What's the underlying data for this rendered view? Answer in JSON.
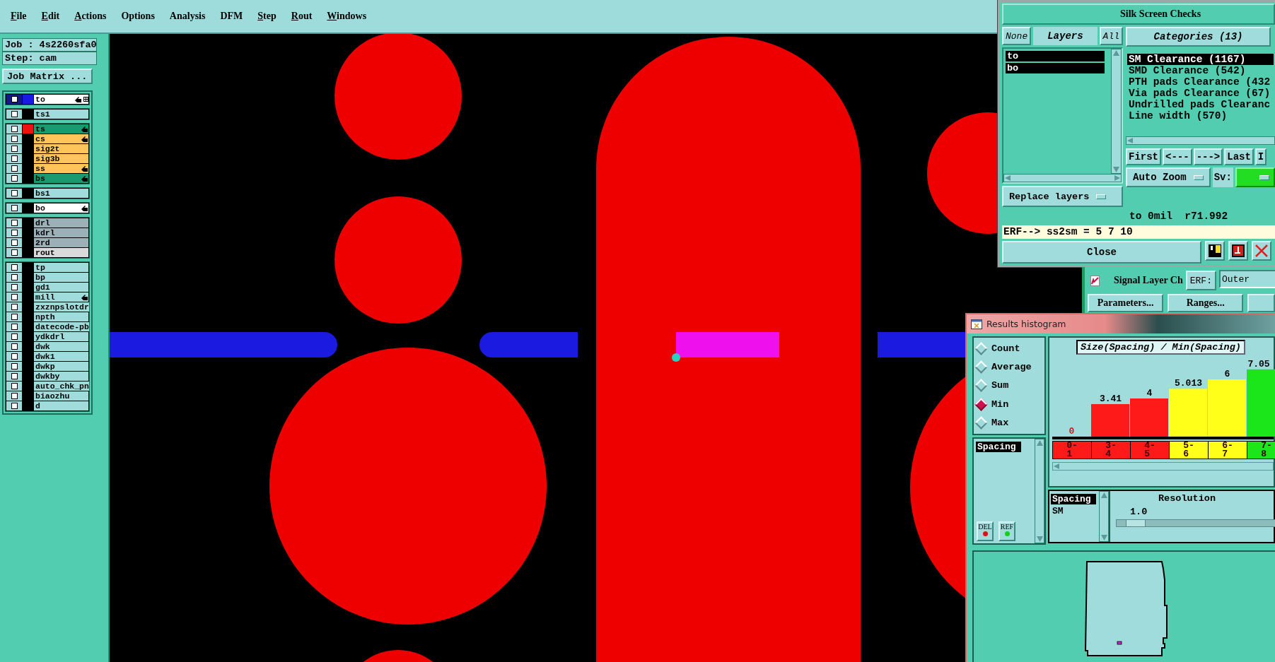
{
  "menu_bar": [
    {
      "label": "File",
      "mnemonic": true
    },
    {
      "label": "Edit",
      "mnemonic": true
    },
    {
      "label": "Actions",
      "mnemonic": true
    },
    {
      "label": "Options",
      "mnemonic": false
    },
    {
      "label": "Analysis",
      "mnemonic": false
    },
    {
      "label": "DFM",
      "mnemonic": false
    },
    {
      "label": "Step",
      "mnemonic": true
    },
    {
      "label": "Rout",
      "mnemonic": true
    },
    {
      "label": "Windows",
      "mnemonic": true
    }
  ],
  "job_panel": {
    "job": "Job : 4s2260sfa0",
    "step": "Step: cam",
    "matrix_button": "Job Matrix ..."
  },
  "layer_groups": [
    {
      "layers": [
        {
          "name": "to",
          "color": "#ffffff",
          "selected": true,
          "affected": true,
          "swatch": {
            "color": "#1a1ae6"
          }
        }
      ]
    },
    {
      "layers": [
        {
          "name": "ts1",
          "color": "#a0dcdc",
          "selected": false,
          "affected": false
        }
      ]
    },
    {
      "layers": [
        {
          "name": "ts",
          "color": "#1a9a70",
          "selected": false,
          "affected": true,
          "swatch": {
            "color": "#ee1111"
          }
        },
        {
          "name": "cs",
          "color": "#ffc55a",
          "selected": false,
          "affected": true
        },
        {
          "name": "sig2t",
          "color": "#ffc55a",
          "selected": false,
          "affected": false
        },
        {
          "name": "sig3b",
          "color": "#ffc55a",
          "selected": false,
          "affected": false
        },
        {
          "name": "ss",
          "color": "#ffc55a",
          "selected": false,
          "affected": true
        },
        {
          "name": "bs",
          "color": "#1a9a70",
          "selected": false,
          "affected": true
        }
      ]
    },
    {
      "layers": [
        {
          "name": "bs1",
          "color": "#a0dcdc",
          "selected": false,
          "affected": false
        }
      ]
    },
    {
      "layers": [
        {
          "name": "bo",
          "color": "#ffffff",
          "selected": false,
          "affected": true
        }
      ]
    },
    {
      "layers": [
        {
          "name": "drl",
          "color": "#9cb0b8",
          "selected": false,
          "affected": false
        },
        {
          "name": "kdrl",
          "color": "#9cb0b8",
          "selected": false,
          "affected": false
        },
        {
          "name": "2rd",
          "color": "#9cb0b8",
          "selected": false,
          "affected": false
        },
        {
          "name": "rout",
          "color": "#dadada",
          "selected": false,
          "affected": false
        }
      ]
    },
    {
      "layers": [
        {
          "name": "tp",
          "color": "#a0dcdc",
          "selected": false,
          "affected": false
        },
        {
          "name": "bp",
          "color": "#a0dcdc",
          "selected": false,
          "affected": false
        },
        {
          "name": "gd1",
          "color": "#a0dcdc",
          "selected": false,
          "affected": false
        },
        {
          "name": "mill",
          "color": "#a0dcdc",
          "selected": false,
          "affected": true
        },
        {
          "name": "zxznpslotdr",
          "color": "#a0dcdc",
          "selected": false,
          "affected": false
        },
        {
          "name": "npth",
          "color": "#a0dcdc",
          "selected": false,
          "affected": false
        },
        {
          "name": "datecode-pb",
          "color": "#a0dcdc",
          "selected": false,
          "affected": false
        },
        {
          "name": "ydkdrl",
          "color": "#a0dcdc",
          "selected": false,
          "affected": false
        },
        {
          "name": "dwk",
          "color": "#a0dcdc",
          "selected": false,
          "affected": false
        },
        {
          "name": "dwk1",
          "color": "#a0dcdc",
          "selected": false,
          "affected": false
        },
        {
          "name": "dwkp",
          "color": "#a0dcdc",
          "selected": false,
          "affected": false
        },
        {
          "name": "dwkby",
          "color": "#a0dcdc",
          "selected": false,
          "affected": false
        },
        {
          "name": "auto_chk_pn",
          "color": "#a0dcdc",
          "selected": false,
          "affected": false
        },
        {
          "name": "biaozhu",
          "color": "#a0dcdc",
          "selected": false,
          "affected": false
        },
        {
          "name": "d",
          "color": "#a0dcdc",
          "selected": false,
          "affected": false
        }
      ]
    }
  ],
  "silk_screen_window": {
    "title": "Silk Screen Checks",
    "none_button": "None",
    "layers_label": "Layers",
    "all_button": "All",
    "layers": [
      {
        "name": "to",
        "selected": true
      },
      {
        "name": "bo",
        "selected": true
      }
    ],
    "replace_button": "Replace layers",
    "categories_button": "Categories (13)",
    "categories": [
      {
        "label": "SM Clearance (1167)",
        "selected": true
      },
      {
        "label": "SMD Clearance (542)",
        "selected": false
      },
      {
        "label": "PTH pads Clearance (432",
        "selected": false
      },
      {
        "label": "Via pads Clearance (67)",
        "selected": false
      },
      {
        "label": "Undrilled pads Clearanc",
        "selected": false
      },
      {
        "label": "Line width (570)",
        "selected": false
      }
    ],
    "nav_buttons": [
      "First",
      "<---",
      "--->",
      "Last",
      "I"
    ],
    "zoom_button": "Auto Zoom",
    "sv_label": "Sv:",
    "status": "to 0mil  r71.992",
    "command": "ERF--> ss2sm = 5 7 10",
    "close_button": "Close"
  },
  "signal_window": {
    "checked": true,
    "title": "Signal Layer Ch",
    "erf_button": "ERF:",
    "erf_value": "Outer",
    "buttons": [
      "Parameters...",
      "Ranges..."
    ]
  },
  "histogram_window": {
    "title": "Results histogram",
    "modes": [
      {
        "label": "Count",
        "selected": false
      },
      {
        "label": "Average",
        "selected": false
      },
      {
        "label": "Sum",
        "selected": false
      },
      {
        "label": "Min",
        "selected": true
      },
      {
        "label": "Max",
        "selected": false
      }
    ],
    "measures": [
      {
        "label": "Spacing",
        "selected": true
      }
    ],
    "del_button": "DEL",
    "ref_button": "REF",
    "chart_data": {
      "type": "bar",
      "title": "Size(Spacing) / Min(Spacing)",
      "categories": [
        "0-1",
        "3-4",
        "4-5",
        "5-6",
        "6-7",
        "7-8"
      ],
      "values": [
        0,
        3.41,
        4,
        5.013,
        6,
        7.05
      ],
      "value_labels": [
        "0",
        "3.41",
        "4",
        "5.013",
        "6",
        "7.05"
      ]
    },
    "bins": [
      {
        "color": "#ff1a1a"
      },
      {
        "color": "#ff1a1a"
      },
      {
        "color": "#ff1a1a"
      },
      {
        "color": "#ffff1a"
      },
      {
        "color": "#ffff1a"
      },
      {
        "color": "#1ae61a"
      }
    ],
    "metrics": [
      {
        "label": "Spacing",
        "selected": true
      },
      {
        "label": "SM",
        "selected": false
      }
    ],
    "resolution": {
      "label": "Resolution",
      "value": "1.0",
      "level": 0.05
    }
  }
}
